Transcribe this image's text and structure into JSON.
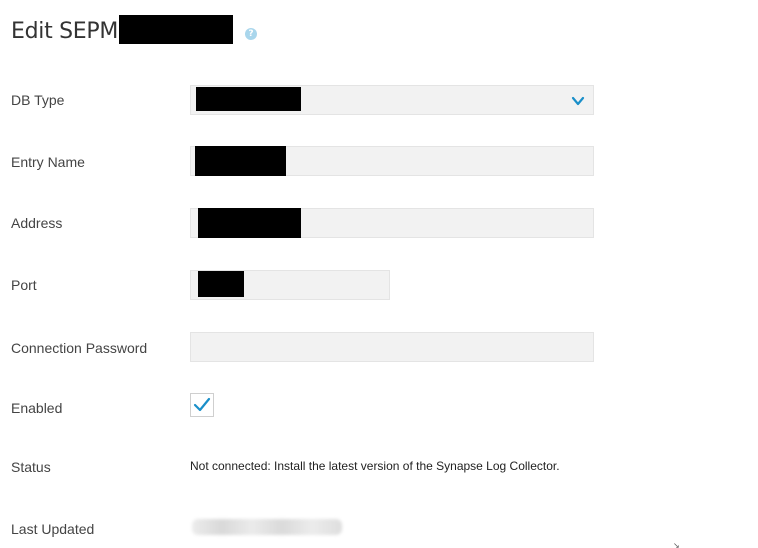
{
  "header": {
    "title": "Edit SEPM:",
    "help_icon": "question-circle-icon"
  },
  "form": {
    "db_type_label": "DB Type",
    "entry_name_label": "Entry Name",
    "address_label": "Address",
    "port_label": "Port",
    "connection_password_label": "Connection Password",
    "enabled_label": "Enabled",
    "enabled_checked": true,
    "status_label": "Status",
    "status_value": "Not connected: Install the latest version of the Synapse Log Collector.",
    "last_updated_label": "Last Updated"
  },
  "colors": {
    "accent": "#1a8fc9",
    "field_background": "#f2f2f2",
    "field_border": "#e4e4e4",
    "redaction": "#000000"
  }
}
